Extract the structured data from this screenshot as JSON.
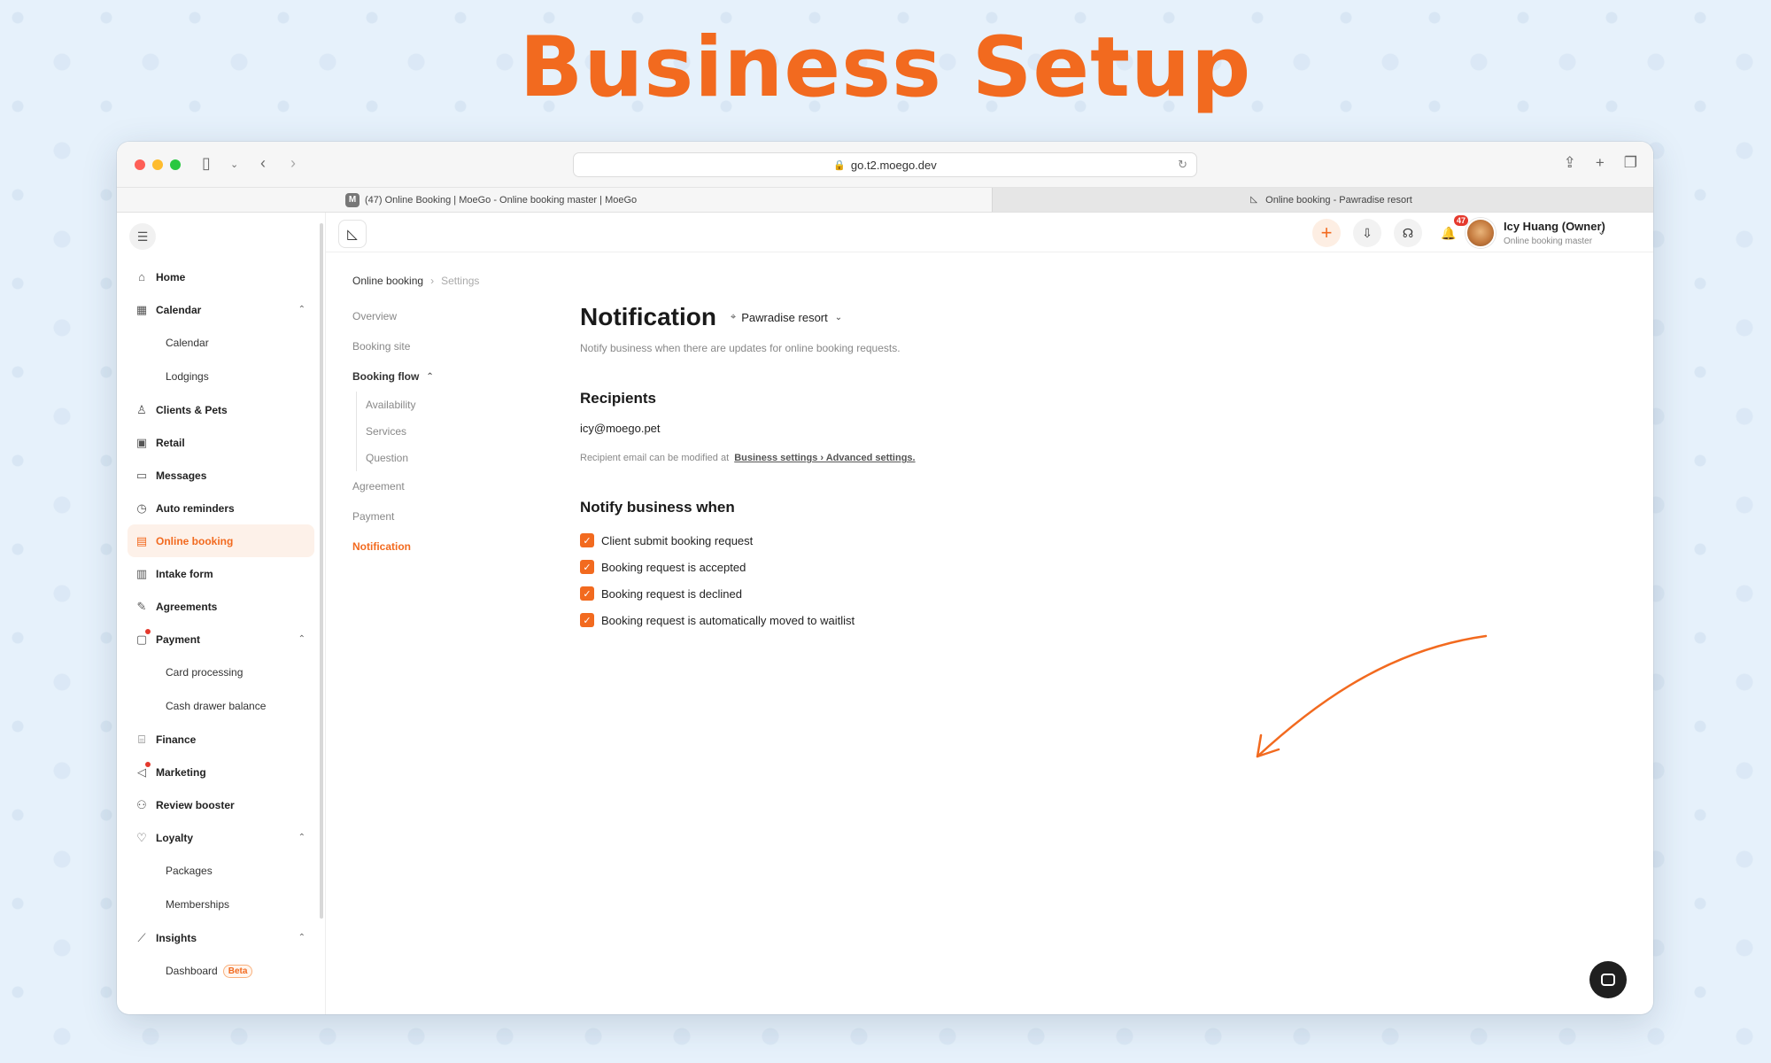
{
  "headline": "Business Setup",
  "browser": {
    "url": "go.t2.moego.dev",
    "tabs": [
      {
        "favicon": "M",
        "label": "(47) Online Booking | MoeGo - Online booking master | MoeGo"
      },
      {
        "favicon": "logo",
        "label": "Online booking - Pawradise resort"
      }
    ]
  },
  "sidebar": {
    "items": [
      {
        "type": "item",
        "icon": "home-icon",
        "glyph": "⌂",
        "label": "Home"
      },
      {
        "type": "item",
        "icon": "calendar-icon",
        "glyph": "▦",
        "label": "Calendar",
        "expanded": true
      },
      {
        "type": "sub",
        "label": "Calendar"
      },
      {
        "type": "sub",
        "label": "Lodgings"
      },
      {
        "type": "item",
        "icon": "clients-icon",
        "glyph": "♙",
        "label": "Clients & Pets"
      },
      {
        "type": "item",
        "icon": "retail-icon",
        "glyph": "▣",
        "label": "Retail"
      },
      {
        "type": "item",
        "icon": "messages-icon",
        "glyph": "▭",
        "label": "Messages"
      },
      {
        "type": "item",
        "icon": "alarm-icon",
        "glyph": "◷",
        "label": "Auto reminders"
      },
      {
        "type": "item",
        "icon": "online-booking-icon",
        "glyph": "▤",
        "label": "Online booking",
        "active": true
      },
      {
        "type": "item",
        "icon": "intake-form-icon",
        "glyph": "▥",
        "label": "Intake form"
      },
      {
        "type": "item",
        "icon": "pen-icon",
        "glyph": "✎",
        "label": "Agreements"
      },
      {
        "type": "item",
        "icon": "payment-icon",
        "glyph": "▢",
        "label": "Payment",
        "expanded": true,
        "dot": true
      },
      {
        "type": "sub",
        "label": "Card processing"
      },
      {
        "type": "sub",
        "label": "Cash drawer balance"
      },
      {
        "type": "item",
        "icon": "finance-icon",
        "glyph": "⌸",
        "label": "Finance"
      },
      {
        "type": "item",
        "icon": "megaphone-icon",
        "glyph": "◁",
        "label": "Marketing",
        "dot": true
      },
      {
        "type": "item",
        "icon": "review-icon",
        "glyph": "⚇",
        "label": "Review booster"
      },
      {
        "type": "item",
        "icon": "loyalty-icon",
        "glyph": "♡",
        "label": "Loyalty",
        "expanded": true
      },
      {
        "type": "sub",
        "label": "Packages"
      },
      {
        "type": "sub",
        "label": "Memberships"
      },
      {
        "type": "item",
        "icon": "insights-icon",
        "glyph": "⟋",
        "label": "Insights",
        "expanded": true
      },
      {
        "type": "sub",
        "label": "Dashboard",
        "badge": "Beta"
      }
    ]
  },
  "topbar": {
    "notif_count": "47",
    "user_name": "Icy Huang (Owner)",
    "user_role": "Online booking master"
  },
  "breadcrumb": {
    "parent": "Online booking",
    "current": "Settings"
  },
  "subnav": {
    "overview": "Overview",
    "booking_site": "Booking site",
    "booking_flow": "Booking flow",
    "availability": "Availability",
    "services": "Services",
    "question": "Question",
    "agreement": "Agreement",
    "payment": "Payment",
    "notification": "Notification"
  },
  "content": {
    "title": "Notification",
    "location": "Pawradise resort",
    "description": "Notify business when there are updates for online booking requests.",
    "recipients_title": "Recipients",
    "recipient_email": "icy@moego.pet",
    "recipient_note": "Recipient email can be modified at",
    "recipient_link": "Business settings › Advanced settings.",
    "notify_title": "Notify business when",
    "checks": [
      {
        "label": "Client submit booking request",
        "checked": true
      },
      {
        "label": "Booking request is accepted",
        "checked": true
      },
      {
        "label": "Booking request is declined",
        "checked": true
      },
      {
        "label": "Booking request is automatically moved to waitlist",
        "checked": true
      }
    ]
  },
  "colors": {
    "accent": "#f26a1f",
    "badge": "#e5392d"
  }
}
